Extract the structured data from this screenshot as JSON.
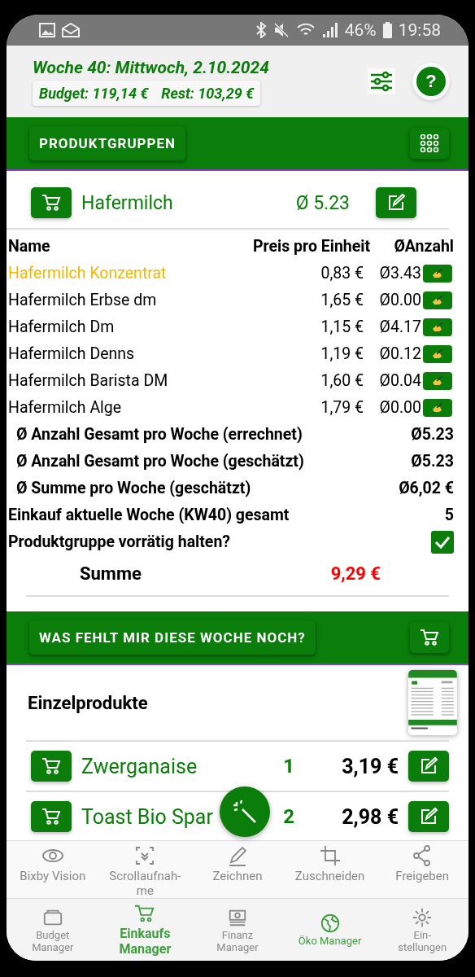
{
  "status_bar": {
    "battery": "46%",
    "time": "19:58"
  },
  "header": {
    "title": "Woche 40: Mittwoch, 2.10.2024",
    "budget": "Budget: 119,14 €",
    "rest": "Rest: 103,29 €",
    "help": "?"
  },
  "groups_bar": {
    "label": "PRODUKTGRUPPEN"
  },
  "group": {
    "name": "Hafermilch",
    "average": "Ø 5.23",
    "columns": [
      "Name",
      "Preis pro Einheit",
      "ØAnzahl"
    ],
    "rows": [
      {
        "name": "Hafermilch Konzentrat",
        "price": "0,83 €",
        "avg": "Ø3.43",
        "highlighted": true
      },
      {
        "name": "Hafermilch Erbse dm",
        "price": "1,65 €",
        "avg": "Ø0.00",
        "highlighted": false
      },
      {
        "name": "Hafermilch Dm",
        "price": "1,15 €",
        "avg": "Ø4.17",
        "highlighted": false
      },
      {
        "name": "Hafermilch Denns",
        "price": "1,19 €",
        "avg": "Ø0.12",
        "highlighted": false
      },
      {
        "name": "Hafermilch Barista DM",
        "price": "1,60 €",
        "avg": "Ø0.04",
        "highlighted": false
      },
      {
        "name": "Hafermilch Alge",
        "price": "1,79 €",
        "avg": "Ø0.00",
        "highlighted": false
      }
    ],
    "stats": [
      {
        "label": "Ø Anzahl Gesamt pro Woche (errechnet)",
        "value": "Ø5.23",
        "indented": true
      },
      {
        "label": "Ø Anzahl Gesamt pro Woche (geschätzt)",
        "value": "Ø5.23",
        "indented": true
      },
      {
        "label": "Ø Summe pro Woche (geschätzt)",
        "value": "Ø6,02 €",
        "indented": true
      },
      {
        "label": "Einkauf aktuelle Woche (KW40) gesamt",
        "value": "5",
        "indented": false
      }
    ],
    "keep_in_stock": {
      "label": "Produktgruppe vorrätig halten?",
      "checked": true
    },
    "sum": {
      "label": "Summe",
      "value": "9,29 €"
    }
  },
  "missing_bar": {
    "label": "WAS FEHLT MIR DIESE WOCHE NOCH?"
  },
  "single_products": {
    "title": "Einzelprodukte",
    "items": [
      {
        "name": "Zwerganaise",
        "count": "1",
        "price": "3,19 €"
      },
      {
        "name": "Toast Bio Spar",
        "count": "2",
        "price": "2,98 €"
      }
    ]
  },
  "screenshot_toolbar": [
    {
      "label": "Bixby Vision"
    },
    {
      "label": "Scrollaufnah-me"
    },
    {
      "label": "Zeichnen"
    },
    {
      "label": "Zuschneiden"
    },
    {
      "label": "Freigeben"
    }
  ],
  "nav": [
    {
      "label": "Budget Manager",
      "selected": false,
      "color": "#8a8a8a"
    },
    {
      "label": "Einkaufs Manager",
      "selected": true,
      "color": "#3f9f3f"
    },
    {
      "label": "Finanz Manager",
      "selected": false,
      "color": "#8a8a8a"
    },
    {
      "label": "Öko Manager",
      "selected": false,
      "color": "#3f9f3f"
    },
    {
      "label": "Ein-stellungen",
      "selected": false,
      "color": "#8a8a8a"
    }
  ]
}
